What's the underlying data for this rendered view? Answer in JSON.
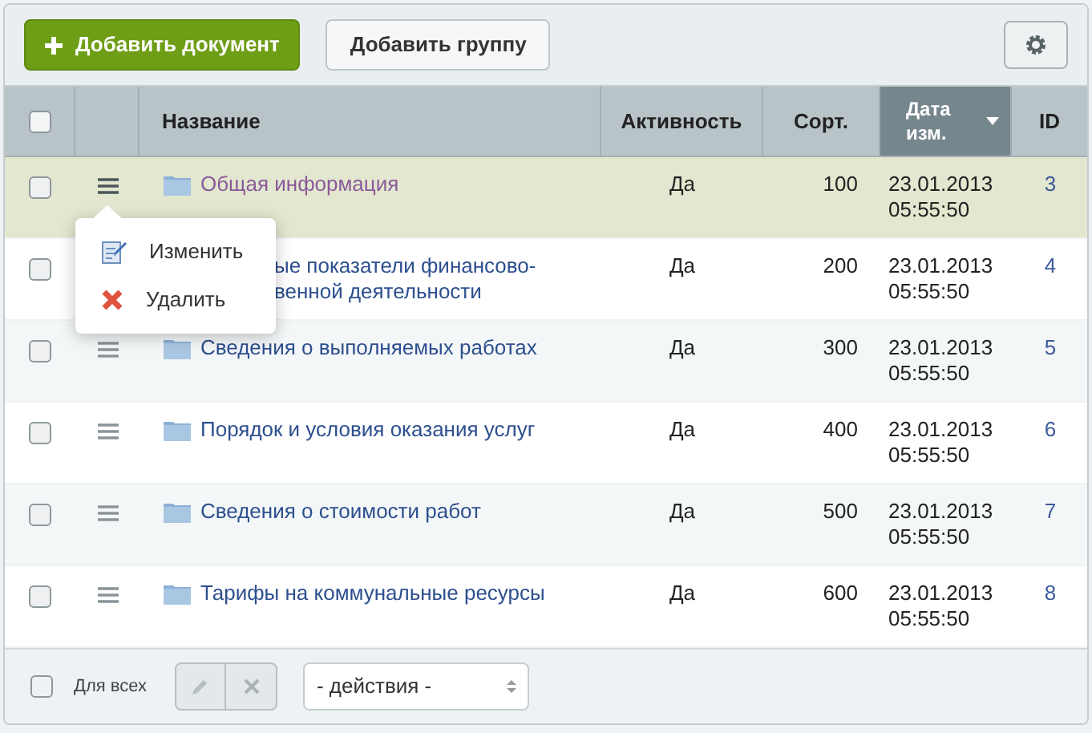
{
  "toolbar": {
    "add_document": "Добавить документ",
    "add_group": "Добавить группу"
  },
  "header_checked": false,
  "columns": [
    {
      "label": "Название",
      "sorted": false
    },
    {
      "label": "Активность",
      "sorted": false
    },
    {
      "label": "Сорт.",
      "sorted": false
    },
    {
      "label": "Дата изм.",
      "sorted": true
    },
    {
      "label": "ID",
      "sorted": false
    }
  ],
  "rows": [
    {
      "name": "Общая информация",
      "covered": false,
      "highlighted": true,
      "checked": false,
      "active": "Да",
      "sort": "100",
      "date": "23.01.2013",
      "time": "05:55:50",
      "id": "3"
    },
    {
      "name": "ые показатели финансово-\nвенной деятельности",
      "covered": true,
      "highlighted": false,
      "checked": false,
      "active": "Да",
      "sort": "200",
      "date": "23.01.2013",
      "time": "05:55:50",
      "id": "4"
    },
    {
      "name": "Сведения о выполняемых работах",
      "covered": false,
      "highlighted": false,
      "checked": false,
      "active": "Да",
      "sort": "300",
      "date": "23.01.2013",
      "time": "05:55:50",
      "id": "5"
    },
    {
      "name": "Порядок и условия оказания услуг",
      "covered": false,
      "highlighted": false,
      "checked": false,
      "active": "Да",
      "sort": "400",
      "date": "23.01.2013",
      "time": "05:55:50",
      "id": "6"
    },
    {
      "name": "Сведения о стоимости работ",
      "covered": false,
      "highlighted": false,
      "checked": false,
      "active": "Да",
      "sort": "500",
      "date": "23.01.2013",
      "time": "05:55:50",
      "id": "7"
    },
    {
      "name": "Тарифы на коммунальные ресурсы",
      "covered": false,
      "highlighted": false,
      "checked": false,
      "active": "Да",
      "sort": "600",
      "date": "23.01.2013",
      "time": "05:55:50",
      "id": "8"
    }
  ],
  "context_menu": [
    {
      "kind": "edit",
      "label": "Изменить"
    },
    {
      "kind": "delete",
      "label": "Удалить"
    }
  ],
  "footer": {
    "for_all": "Для всех",
    "for_all_checked": false,
    "actions": "- действия -"
  }
}
